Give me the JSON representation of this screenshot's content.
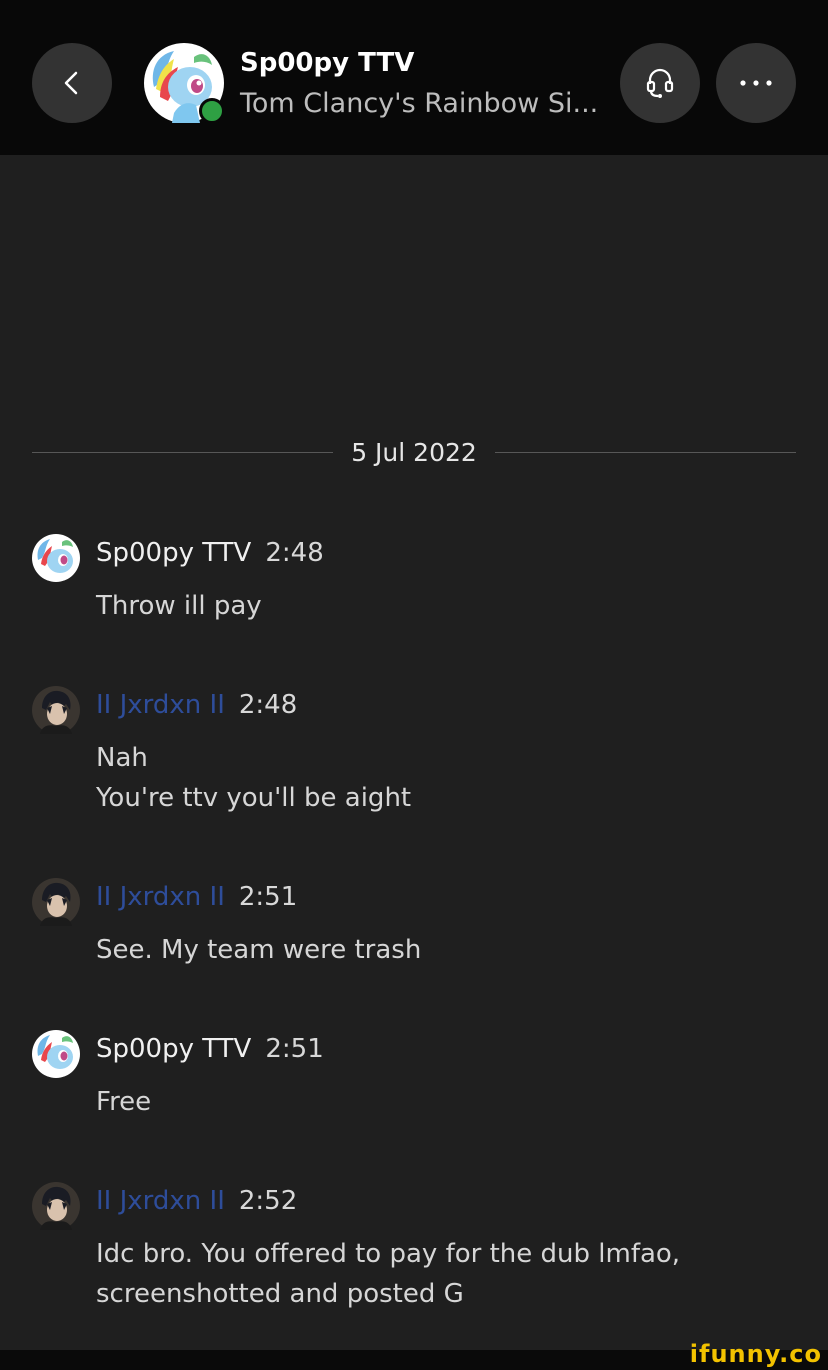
{
  "header": {
    "name": "Sp00py TTV",
    "status": "Tom Clancy's Rainbow Si...",
    "online": true
  },
  "date_separator": "5 Jul 2022",
  "messages": [
    {
      "author": "Sp00py TTV",
      "time": "2:48",
      "lines": [
        "Throw ill pay"
      ],
      "avatar": "pony-avatar"
    },
    {
      "author": "II Jxrdxn II",
      "time": "2:48",
      "lines": [
        "Nah",
        "You're ttv you'll be aight"
      ],
      "avatar": "anime-avatar"
    },
    {
      "author": "II Jxrdxn II",
      "time": "2:51",
      "lines": [
        "See. My team were trash"
      ],
      "avatar": "anime-avatar"
    },
    {
      "author": "Sp00py TTV",
      "time": "2:51",
      "lines": [
        "Free"
      ],
      "avatar": "pony-avatar"
    },
    {
      "author": "II Jxrdxn II",
      "time": "2:52",
      "lines": [
        "Idc bro. You offered to pay for the dub lmfao,",
        "screenshotted and posted G"
      ],
      "avatar": "anime-avatar"
    }
  ],
  "watermark": "ifunny.co",
  "colors": {
    "background": "#1f1f1f",
    "topbar": "#080808",
    "button": "#333333",
    "online": "#2ea043",
    "friend_name": "#2e4d9a",
    "watermark": "#f2c200"
  },
  "icons": {
    "back": "chevron-left-icon",
    "headset": "headset-icon",
    "more": "more-icon"
  }
}
